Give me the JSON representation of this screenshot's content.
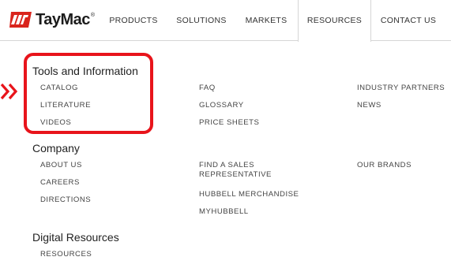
{
  "brand": {
    "name": "TayMac",
    "registered": "®",
    "accent_color": "#d9241c",
    "annotation_color": "#e8141b"
  },
  "nav": {
    "items": [
      {
        "label": "PRODUCTS"
      },
      {
        "label": "SOLUTIONS"
      },
      {
        "label": "MARKETS"
      },
      {
        "label": "RESOURCES",
        "active": true
      },
      {
        "label": "CONTACT US"
      }
    ]
  },
  "menu": {
    "tools": {
      "title": "Tools and Information",
      "col1": [
        "CATALOG",
        "LITERATURE",
        "VIDEOS"
      ],
      "col2": [
        "FAQ",
        "GLOSSARY",
        "PRICE SHEETS"
      ],
      "col3": [
        "INDUSTRY PARTNERS",
        "NEWS"
      ]
    },
    "company": {
      "title": "Company",
      "col1": [
        "ABOUT US",
        "CAREERS",
        "DIRECTIONS"
      ],
      "col2_line1": "FIND A SALES",
      "col2_line2": "REPRESENTATIVE",
      "col2_rest": [
        "HUBBELL MERCHANDISE",
        "MYHUBBELL"
      ],
      "col3": [
        "OUR BRANDS"
      ]
    },
    "digital": {
      "title": "Digital Resources",
      "col1": [
        "RESOURCES"
      ]
    }
  },
  "icons": {
    "logo": "taymac-flag-logo",
    "annotation_arrow": "double-chevron-right-icon"
  }
}
